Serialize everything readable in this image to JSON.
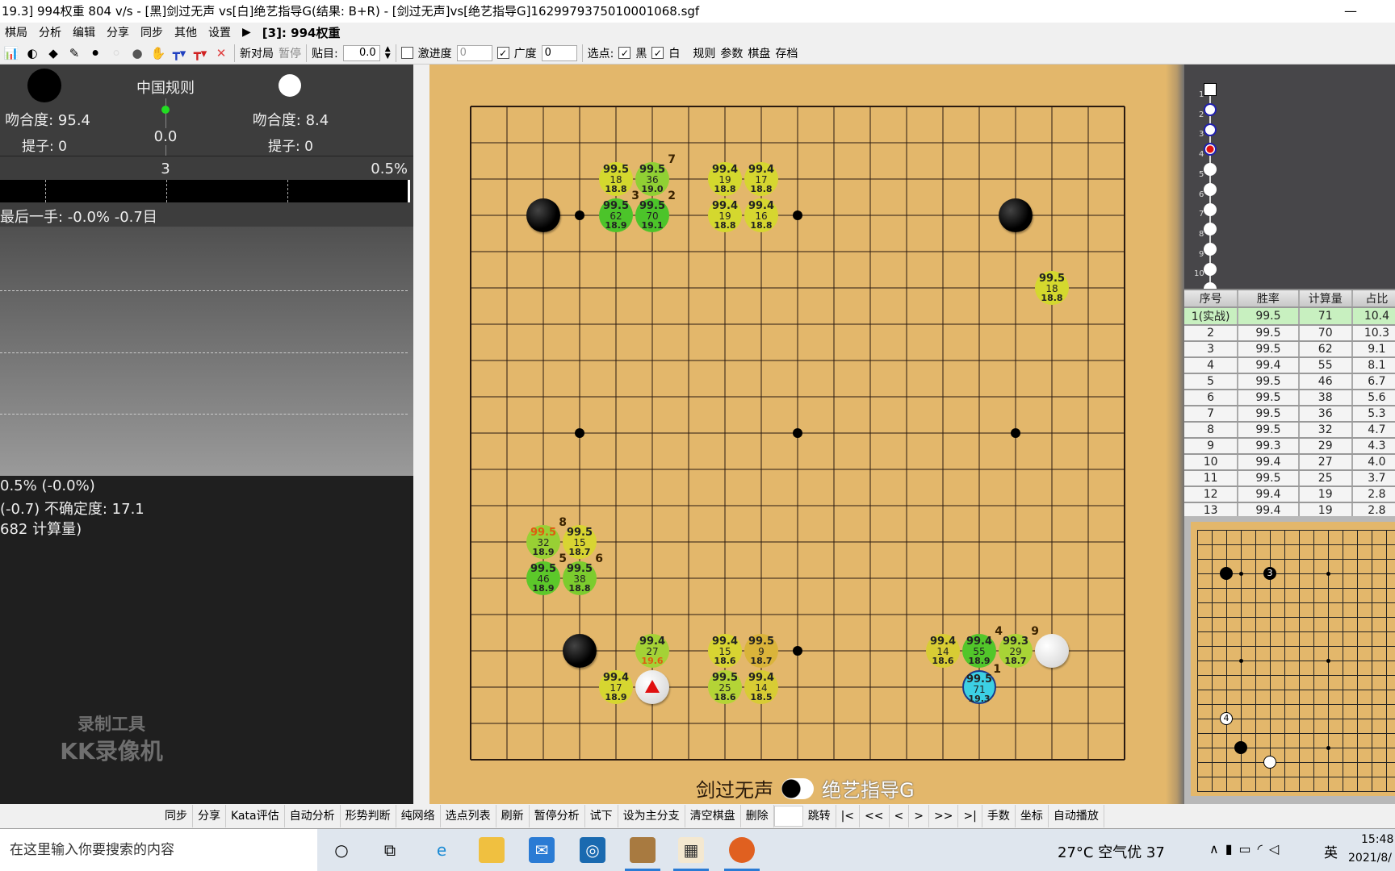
{
  "window": {
    "title": "19.3] 994权重 804 v/s - [黑]剑过无声 vs[白]绝艺指导G(结果: B+R) - [剑过无声]vs[绝艺指导G]1629979375010001068.sgf",
    "minimize": "—"
  },
  "menu": {
    "items": [
      "棋局",
      "分析",
      "编辑",
      "分享",
      "同步",
      "其他",
      "设置"
    ],
    "engine": "[3]: 994权重"
  },
  "toolbar": {
    "new_game": "新对局",
    "pause": "暂停",
    "komi_label": "贴目:",
    "komi_value": "0.0",
    "aggr_label": "激进度",
    "aggr_value": "0",
    "aggr_checked": false,
    "width_label": "广度",
    "width_value": "0",
    "width_checked": true,
    "pick_label": "选点:",
    "black_label": "黑",
    "white_label": "白",
    "rules": "规则",
    "params": "参数",
    "board": "棋盘",
    "save": "存档"
  },
  "stats": {
    "rule": "中国规则",
    "score": "0.0",
    "black_match": "吻合度: 95.4",
    "white_match": "吻合度: 8.4",
    "black_captures": "提子: 0",
    "white_captures": "提子: 0",
    "move_number": "3",
    "winrate_right": "0.5%",
    "winrate_bar_white_fraction": 0.005,
    "last_move": "最后一手: -0.0% -0.7目"
  },
  "analysis": {
    "line1": "0.5% (-0.0%)",
    "line2": "(-0.7) 不确定度: 17.1",
    "line3": "682 计算量)"
  },
  "watermark": {
    "line1": "录制工具",
    "line2": "KK录像机"
  },
  "players": {
    "black": "剑过无声",
    "white": "绝艺指导G"
  },
  "board": {
    "size": 19,
    "black": [
      "C16",
      "Q16",
      "D4"
    ],
    "white": [
      "F3",
      "R4"
    ],
    "last_move": "F3",
    "candidates": [
      {
        "point": "P3",
        "win": "99.5",
        "visits": "71",
        "score": "19.3",
        "rank": "1",
        "color": "#3cd0e4"
      },
      {
        "point": "F16",
        "win": "99.5",
        "visits": "70",
        "score": "19.1",
        "rank": "2",
        "color": "#4cc42a"
      },
      {
        "point": "E16",
        "win": "99.5",
        "visits": "62",
        "score": "18.9",
        "rank": "3",
        "color": "#4cc42a"
      },
      {
        "point": "P4",
        "win": "99.4",
        "visits": "55",
        "score": "18.9",
        "rank": "4",
        "color": "#52c62a"
      },
      {
        "point": "C6",
        "win": "99.5",
        "visits": "46",
        "score": "18.9",
        "rank": "5",
        "color": "#5cc82a"
      },
      {
        "point": "D6",
        "win": "99.5",
        "visits": "38",
        "score": "18.8",
        "rank": "6",
        "color": "#7ccc2e"
      },
      {
        "point": "F17",
        "win": "99.5",
        "visits": "36",
        "score": "19.0",
        "rank": "7",
        "color": "#90d034"
      },
      {
        "point": "C7",
        "win": "99.5",
        "visits": "32",
        "score": "18.9",
        "rank": "8",
        "color": "#98d034",
        "win_color": "#e05a10"
      },
      {
        "point": "Q4",
        "win": "99.3",
        "visits": "29",
        "score": "18.7",
        "rank": "9",
        "color": "#a8d436"
      },
      {
        "point": "F4",
        "win": "99.4",
        "visits": "27",
        "score": "19.6",
        "rank": "",
        "color": "#a4d236",
        "score_color": "#e05a10"
      },
      {
        "point": "H3",
        "win": "99.5",
        "visits": "25",
        "score": "18.6",
        "rank": "",
        "color": "#b4d436"
      },
      {
        "point": "H17",
        "win": "99.4",
        "visits": "19",
        "score": "18.8",
        "rank": "",
        "color": "#d4d82e"
      },
      {
        "point": "H16",
        "win": "99.4",
        "visits": "19",
        "score": "18.8",
        "rank": "",
        "color": "#d4d82e"
      },
      {
        "point": "E17",
        "win": "99.5",
        "visits": "18",
        "score": "18.8",
        "rank": "",
        "color": "#d4d82e"
      },
      {
        "point": "R14",
        "win": "99.5",
        "visits": "18",
        "score": "18.8",
        "rank": "",
        "color": "#d4d82e"
      },
      {
        "point": "J17",
        "win": "99.4",
        "visits": "17",
        "score": "18.8",
        "rank": "",
        "color": "#d6d630"
      },
      {
        "point": "E3",
        "win": "99.4",
        "visits": "17",
        "score": "18.9",
        "rank": "",
        "color": "#d6d630"
      },
      {
        "point": "J16",
        "win": "99.4",
        "visits": "16",
        "score": "18.8",
        "rank": "",
        "color": "#d6d630"
      },
      {
        "point": "D7",
        "win": "99.5",
        "visits": "15",
        "score": "18.7",
        "rank": "",
        "color": "#d8d432"
      },
      {
        "point": "H4",
        "win": "99.4",
        "visits": "15",
        "score": "18.6",
        "rank": "",
        "color": "#d8d432"
      },
      {
        "point": "J3",
        "win": "99.4",
        "visits": "14",
        "score": "18.5",
        "rank": "",
        "color": "#d8cc34"
      },
      {
        "point": "O4",
        "win": "99.4",
        "visits": "14",
        "score": "18.6",
        "rank": "",
        "color": "#d8cc34"
      },
      {
        "point": "J4",
        "win": "99.5",
        "visits": "9",
        "score": "18.7",
        "rank": "",
        "color": "#dab43a"
      }
    ]
  },
  "tree": {
    "numbers": [
      "1",
      "2",
      "3",
      "4",
      "5",
      "6",
      "7",
      "8",
      "9",
      "10"
    ],
    "current": 3
  },
  "table": {
    "headers": [
      "序号",
      "胜率",
      "计算量",
      "占比"
    ],
    "rows": [
      [
        "1(实战)",
        "99.5",
        "71",
        "10.4"
      ],
      [
        "2",
        "99.5",
        "70",
        "10.3"
      ],
      [
        "3",
        "99.5",
        "62",
        "9.1"
      ],
      [
        "4",
        "99.4",
        "55",
        "8.1"
      ],
      [
        "5",
        "99.5",
        "46",
        "6.7"
      ],
      [
        "6",
        "99.5",
        "38",
        "5.6"
      ],
      [
        "7",
        "99.5",
        "36",
        "5.3"
      ],
      [
        "8",
        "99.5",
        "32",
        "4.7"
      ],
      [
        "9",
        "99.3",
        "29",
        "4.3"
      ],
      [
        "10",
        "99.4",
        "27",
        "4.0"
      ],
      [
        "11",
        "99.5",
        "25",
        "3.7"
      ],
      [
        "12",
        "99.4",
        "19",
        "2.8"
      ],
      [
        "13",
        "99.4",
        "19",
        "2.8"
      ]
    ]
  },
  "mini_board": {
    "black": [
      {
        "point": "C16",
        "label": ""
      },
      {
        "point": "F16",
        "label": "3"
      },
      {
        "point": "D4",
        "label": ""
      }
    ],
    "white": [
      {
        "point": "C6",
        "label": "4"
      },
      {
        "point": "F3",
        "label": ""
      }
    ]
  },
  "bottom_buttons": [
    "同步",
    "分享",
    "Kata评估",
    "自动分析",
    "形势判断",
    "纯网络",
    "选点列表",
    "刷新",
    "暂停分析",
    "试下",
    "设为主分支",
    "清空棋盘",
    "删除",
    "",
    "跳转",
    "|<",
    "<<",
    "<",
    ">",
    ">>",
    ">|",
    "手数",
    "坐标",
    "自动播放"
  ],
  "taskbar": {
    "search_placeholder": "在这里输入你要搜索的内容",
    "weather": "27°C 空气优 37",
    "ime": "英",
    "time": "15:48",
    "date": "2021/8/"
  }
}
